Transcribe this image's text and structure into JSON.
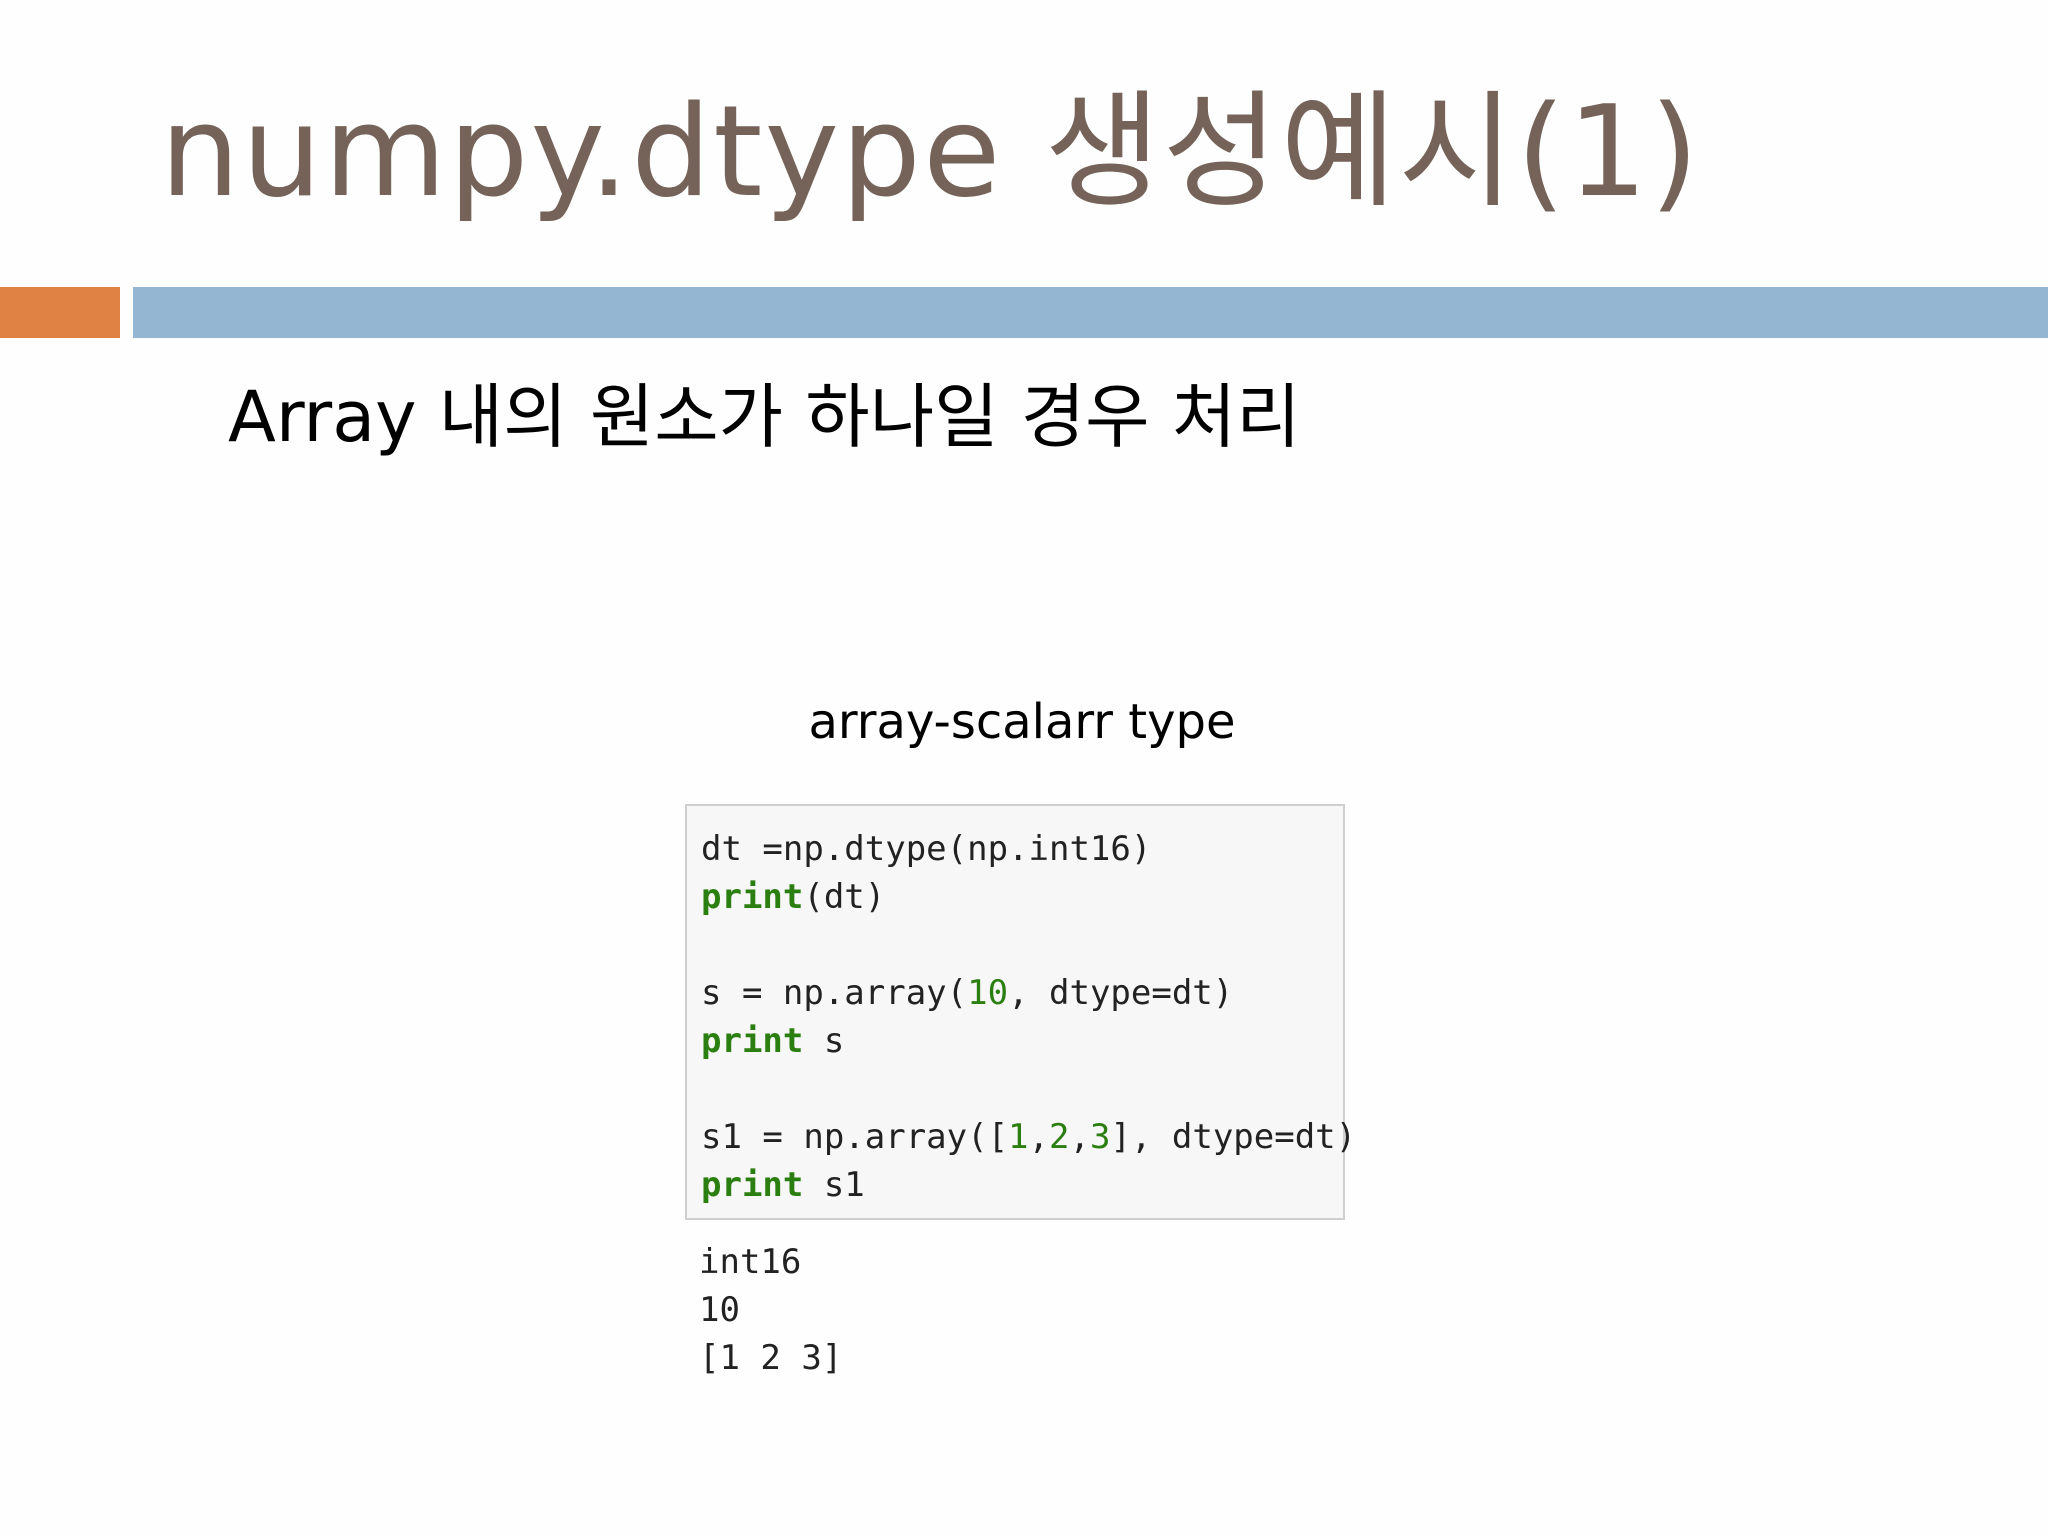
{
  "slide": {
    "title": "numpy.dtype 생성예시(1)",
    "bullet": "Array 내의 원소가 하나일 경우 처리",
    "caption": "array-scalarr type"
  },
  "code": {
    "line1": "dt =np.dtype(np.int16)",
    "line2_kw": "print",
    "line2_rest": "(dt)",
    "line3_a": "s = np.array(",
    "line3_num": "10",
    "line3_b": ", dtype=dt)",
    "line4_kw": "print",
    "line4_rest": " s",
    "line5_a": "s1 = np.array([",
    "line5_n1": "1",
    "line5_c1": ",",
    "line5_n2": "2",
    "line5_c2": ",",
    "line5_n3": "3",
    "line5_b": "], dtype=dt)",
    "line6_kw": "print",
    "line6_rest": " s1"
  },
  "output": [
    "int16",
    "10",
    "[1 2 3]"
  ],
  "colors": {
    "title": "#756359",
    "accent_orange": "#df8244",
    "accent_blue": "#94b6d2",
    "keyword_green": "#2a7f10"
  }
}
